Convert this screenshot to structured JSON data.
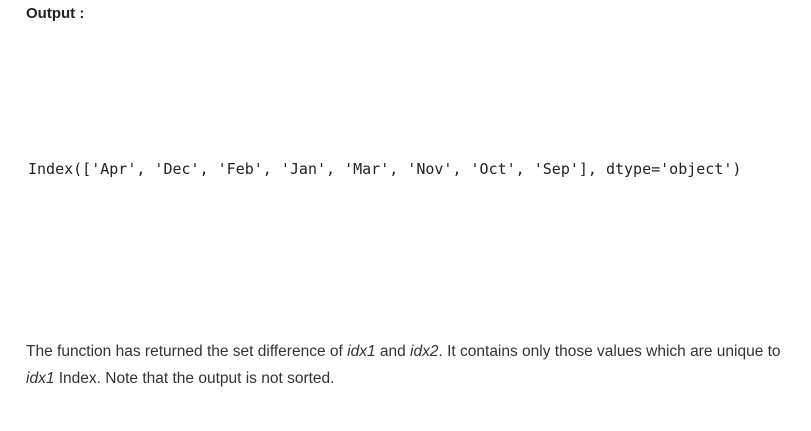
{
  "heading": "Output :",
  "code_output": "Index(['Apr', 'Dec', 'Feb', 'Jan', 'Mar', 'Nov', 'Oct', 'Sep'], dtype='object')",
  "description": {
    "part1": "The function has returned the set difference of ",
    "var1": "idx1",
    "part2": " and ",
    "var2": "idx2",
    "part3": ". It contains only those values which are unique to ",
    "var3": "idx1",
    "part4": " Index. Note that the output is not sorted."
  }
}
